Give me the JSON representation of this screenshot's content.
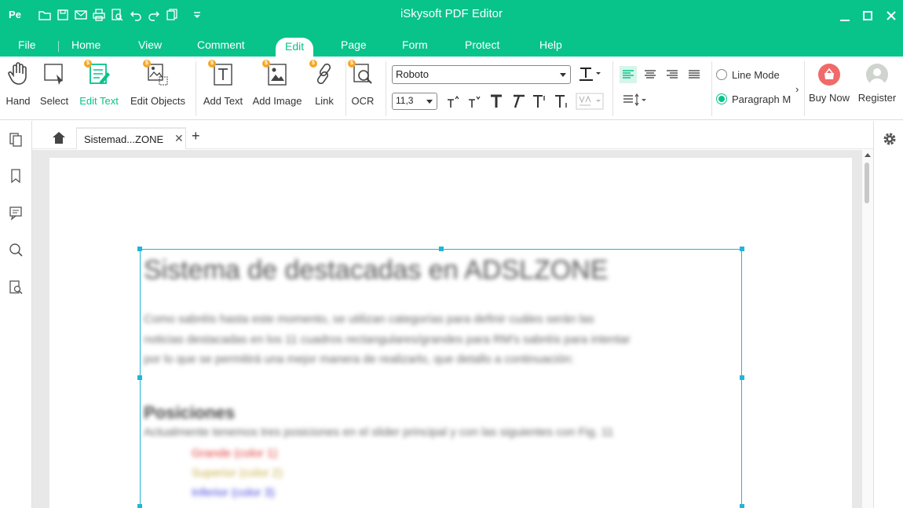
{
  "app": {
    "logo": "Pe",
    "title": "iSkysoft PDF Editor"
  },
  "quick_access": [
    "open-folder-icon",
    "save-icon",
    "mail-icon",
    "print-icon",
    "print-preview-icon",
    "undo-icon",
    "redo-icon",
    "copy-icon",
    "customize-dropdown-icon"
  ],
  "menu": {
    "tabs": [
      "File",
      "Home",
      "View",
      "Comment",
      "Edit",
      "Page",
      "Form",
      "Protect",
      "Help"
    ],
    "active": "Edit"
  },
  "ribbon": {
    "hand": "Hand",
    "select": "Select",
    "edit_text": "Edit Text",
    "edit_objects": "Edit Objects",
    "add_text": "Add Text",
    "add_image": "Add Image",
    "link": "Link",
    "ocr": "OCR",
    "font_name": "Roboto",
    "font_size": "11,3",
    "line_mode": "Line Mode",
    "paragraph_mode": "Paragraph M",
    "paragraph_mode_selected": true,
    "buy_now": "Buy Now",
    "register": "Register"
  },
  "tabs": {
    "doc_title": "Sistemad...ZONE"
  },
  "document": {
    "heading": "Sistema de destacadas en ADSLZONE",
    "para1_line1": "Como sabréis hasta este momento, se utilizan categorías para definir cuáles serán las",
    "para1_line2": "noticias destacadas en los 11 cuadros rectangulares/grandes para RM's sabréis para intentar",
    "para1_line3": "por lo que se permitirá una mejor manera de realizarlo, que detallo a continuación:",
    "subheading": "Posiciones",
    "para2": "Actualmente tenemos tres posiciones en el slider principal y con las siguientes con Fig. 11",
    "items": [
      "Grande (color 1)",
      "Superior (color 2)",
      "Inferior (color 3)"
    ],
    "item_colors": [
      "#e23b3b",
      "#c9b04a",
      "#4a4ae0"
    ]
  },
  "colors": {
    "accent": "#08c38a",
    "selection": "#22b5d6"
  }
}
